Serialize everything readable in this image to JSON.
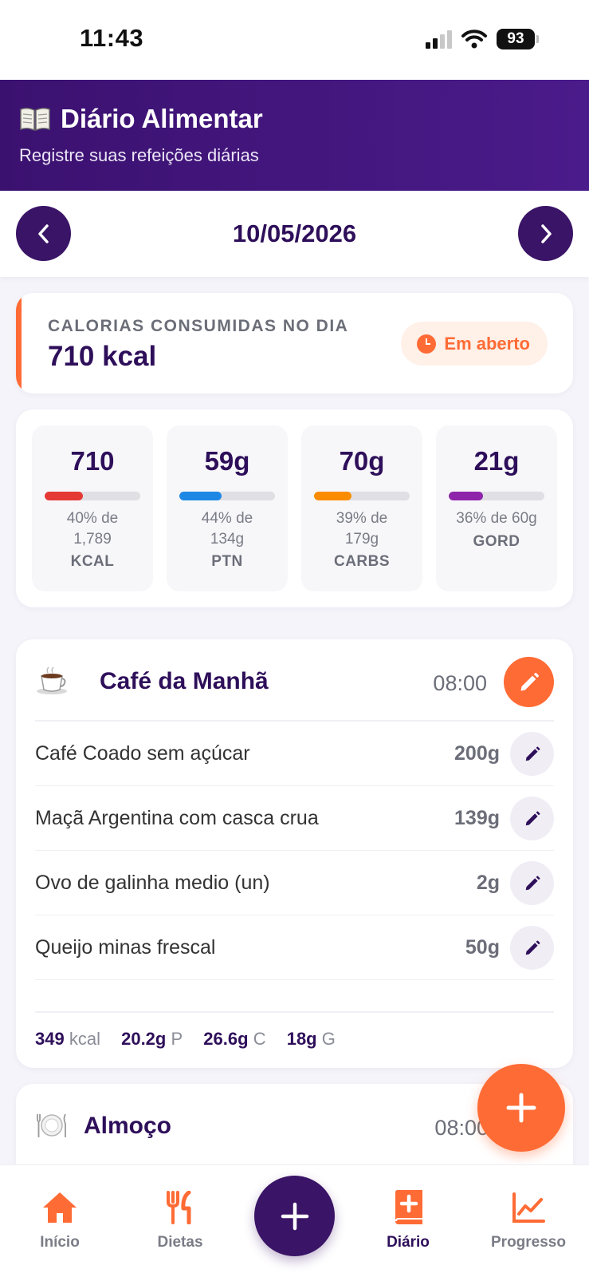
{
  "status_bar": {
    "time": "11:43",
    "battery": "93"
  },
  "header": {
    "title": "Diário Alimentar",
    "subtitle": "Registre suas refeições diárias"
  },
  "date_nav": {
    "date": "10/05/2026"
  },
  "calories": {
    "label": "CALORIAS CONSUMIDAS NO DIA",
    "value": "710 kcal",
    "status": "Em aberto"
  },
  "macros": [
    {
      "value": "710",
      "pct": "40% de",
      "target": "1,789",
      "name": "KCAL",
      "fill": 40,
      "color": "#e53935"
    },
    {
      "value": "59g",
      "pct": "44% de",
      "target": "134g",
      "name": "PTN",
      "fill": 44,
      "color": "#1e88e5"
    },
    {
      "value": "70g",
      "pct": "39% de",
      "target": "179g",
      "name": "CARBS",
      "fill": 39,
      "color": "#fb8c00"
    },
    {
      "value": "21g",
      "pct": "36% de 60g",
      "target": "",
      "name": "GORD",
      "fill": 36,
      "color": "#8e24aa"
    }
  ],
  "meals": [
    {
      "title": "Café da Manhã",
      "time": "08:00",
      "items": [
        {
          "name": "Café Coado sem açúcar",
          "qty": "200g"
        },
        {
          "name": "Maçã Argentina com casca crua",
          "qty": "139g"
        },
        {
          "name": "Ovo de galinha medio (un)",
          "qty": "2g"
        },
        {
          "name": "Queijo minas frescal",
          "qty": "50g"
        }
      ],
      "totals": {
        "kcal": "349",
        "kcal_unit": "kcal",
        "p": "20.2g",
        "p_unit": "P",
        "c": "26.6g",
        "c_unit": "C",
        "g": "18g",
        "g_unit": "G"
      }
    },
    {
      "title": "Almoço",
      "time": "08:00"
    }
  ],
  "bottom_nav": {
    "inicio": "Início",
    "dietas": "Dietas",
    "diario": "Diário",
    "progresso": "Progresso"
  },
  "colors": {
    "primary": "#3a1466",
    "accent": "#ff6b35"
  }
}
